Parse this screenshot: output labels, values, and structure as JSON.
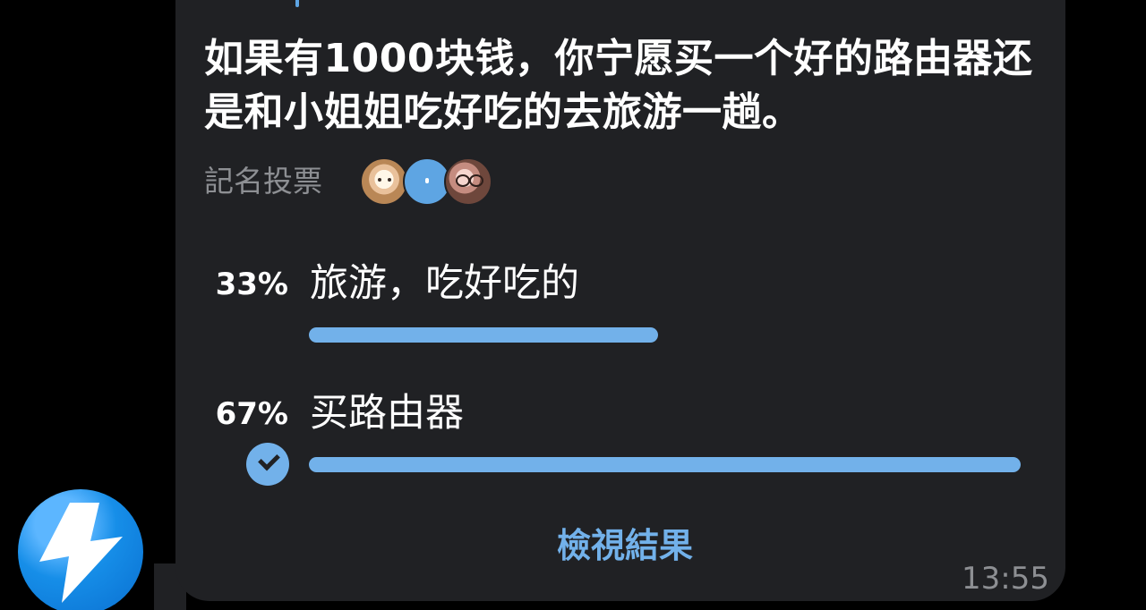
{
  "message": {
    "question": "如果有1000块钱，你宁愿买一个好的路由器还是和小姐姐吃好吃的去旅游一趟。",
    "poll_type": "記名投票",
    "time": "13:55",
    "view_results_label": "檢視結果"
  },
  "poll": {
    "options": [
      {
        "percent": "33%",
        "label": "旅游，吃好吃的",
        "fraction": 0.49,
        "selected": false
      },
      {
        "percent": "67%",
        "label": "买路由器",
        "fraction": 1.0,
        "selected": true
      }
    ]
  },
  "voters": [
    {
      "avatar": "cartoon-avatar"
    },
    {
      "avatar": "blue-avatar"
    },
    {
      "avatar": "person-avatar"
    }
  ],
  "icons": {
    "bot_avatar": "lightning-bolt-icon",
    "selected_check": "check-icon"
  },
  "colors": {
    "background": "#000000",
    "bubble": "#202124",
    "accent": "#72b1ea",
    "text": "#ffffff",
    "muted": "#8d8f93"
  }
}
